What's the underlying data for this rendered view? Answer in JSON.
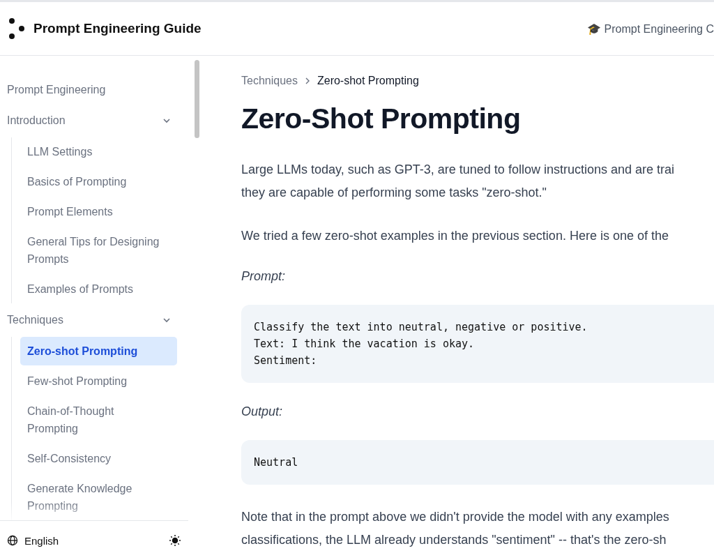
{
  "header": {
    "logo_title": "Prompt Engineering Guide",
    "course_link": "🎓 Prompt Engineering C"
  },
  "sidebar": {
    "items": [
      {
        "label": "Prompt Engineering"
      },
      {
        "label": "Introduction",
        "expanded": true,
        "children": [
          {
            "label": "LLM Settings",
            "selected": false
          },
          {
            "label": "Basics of Prompting",
            "selected": false
          },
          {
            "label": "Prompt Elements",
            "selected": false
          },
          {
            "label": "General Tips for Designing Prompts",
            "selected": false
          },
          {
            "label": "Examples of Prompts",
            "selected": false
          }
        ]
      },
      {
        "label": "Techniques",
        "expanded": true,
        "children": [
          {
            "label": "Zero-shot Prompting",
            "selected": true
          },
          {
            "label": "Few-shot Prompting",
            "selected": false
          },
          {
            "label": "Chain-of-Thought Prompting",
            "selected": false
          },
          {
            "label": "Self-Consistency",
            "selected": false
          },
          {
            "label": "Generate Knowledge Prompting",
            "selected": false
          }
        ]
      }
    ],
    "language": "English"
  },
  "breadcrumb": [
    "Techniques",
    "Zero-shot Prompting"
  ],
  "title": "Zero-Shot Prompting",
  "content": [
    {
      "kind": "paragraph",
      "lines": [
        "Large LLMs today, such as GPT-3, are tuned to follow instructions and are trai",
        "they are capable of performing some tasks \"zero-shot.\""
      ]
    },
    {
      "kind": "paragraph",
      "lines": [
        "We tried a few zero-shot examples in the previous section. Here is one of the"
      ]
    },
    {
      "kind": "label",
      "text": "Prompt:"
    },
    {
      "kind": "code",
      "lines": [
        "Classify the text into neutral, negative or positive.",
        "Text: I think the vacation is okay.",
        "Sentiment:"
      ]
    },
    {
      "kind": "label",
      "text": "Output:"
    },
    {
      "kind": "code",
      "lines": [
        "Neutral"
      ]
    },
    {
      "kind": "paragraph",
      "lines": [
        "Note that in the prompt above we didn't provide the model with any examples",
        "classifications, the LLM already understands \"sentiment\" -- that's the zero-sh"
      ]
    }
  ]
}
